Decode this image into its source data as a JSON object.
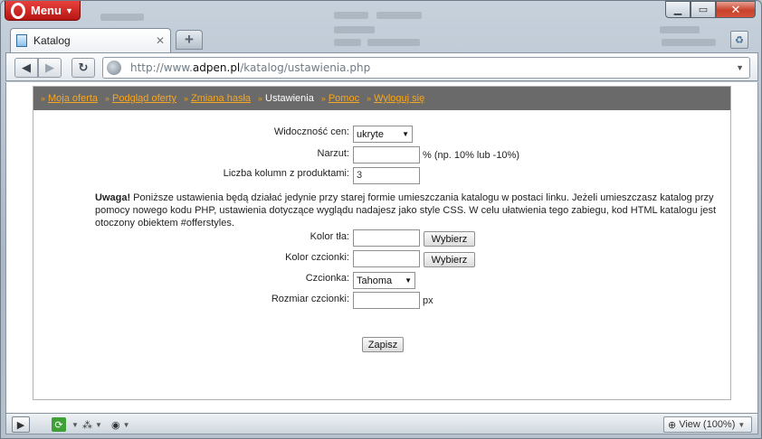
{
  "browser": {
    "menu_label": "Menu",
    "tab_title": "Katalog",
    "tab_close": "✕",
    "new_tab": "+",
    "url_prefix": "http://www.",
    "url_host": "adpen.pl",
    "url_path": "/katalog/ustawienia.php",
    "win_min": "▁",
    "win_max": "▭",
    "win_close": "✕",
    "zoom_label": "View (100%)"
  },
  "nav": [
    {
      "label": "Moja oferta",
      "link": true
    },
    {
      "label": "Podgląd oferty",
      "link": true
    },
    {
      "label": "Zmiana hasła",
      "link": true
    },
    {
      "label": "Ustawienia",
      "link": false
    },
    {
      "label": "Pomoc",
      "link": true
    },
    {
      "label": "Wyloguj się",
      "link": true
    }
  ],
  "nav_bullet": "››",
  "form": {
    "price_visibility_label": "Widoczność cen:",
    "price_visibility_value": "ukryte",
    "markup_label": "Narzut:",
    "markup_value": "",
    "markup_hint": "% (np. 10% lub -10%)",
    "columns_label": "Liczba kolumn z produktami:",
    "columns_value": "3",
    "warning_bold": "Uwaga!",
    "warning_text": " Poniższe ustawienia będą działać jedynie przy starej formie umieszczania katalogu w postaci linku. Jeżeli umieszczasz katalog przy pomocy nowego kodu PHP, ustawienia dotyczące wyglądu nadajesz jako style CSS. W celu ułatwienia tego zabiegu, kod HTML katalogu jest otoczony obiektem #offerstyles.",
    "bg_color_label": "Kolor tła:",
    "bg_color_value": "",
    "font_color_label": "Kolor czcionki:",
    "font_color_value": "",
    "choose_label": "Wybierz",
    "font_label": "Czcionka:",
    "font_value": "Tahoma",
    "font_size_label": "Rozmiar czcionki:",
    "font_size_value": "",
    "font_size_unit": "px",
    "save_label": "Zapisz"
  }
}
